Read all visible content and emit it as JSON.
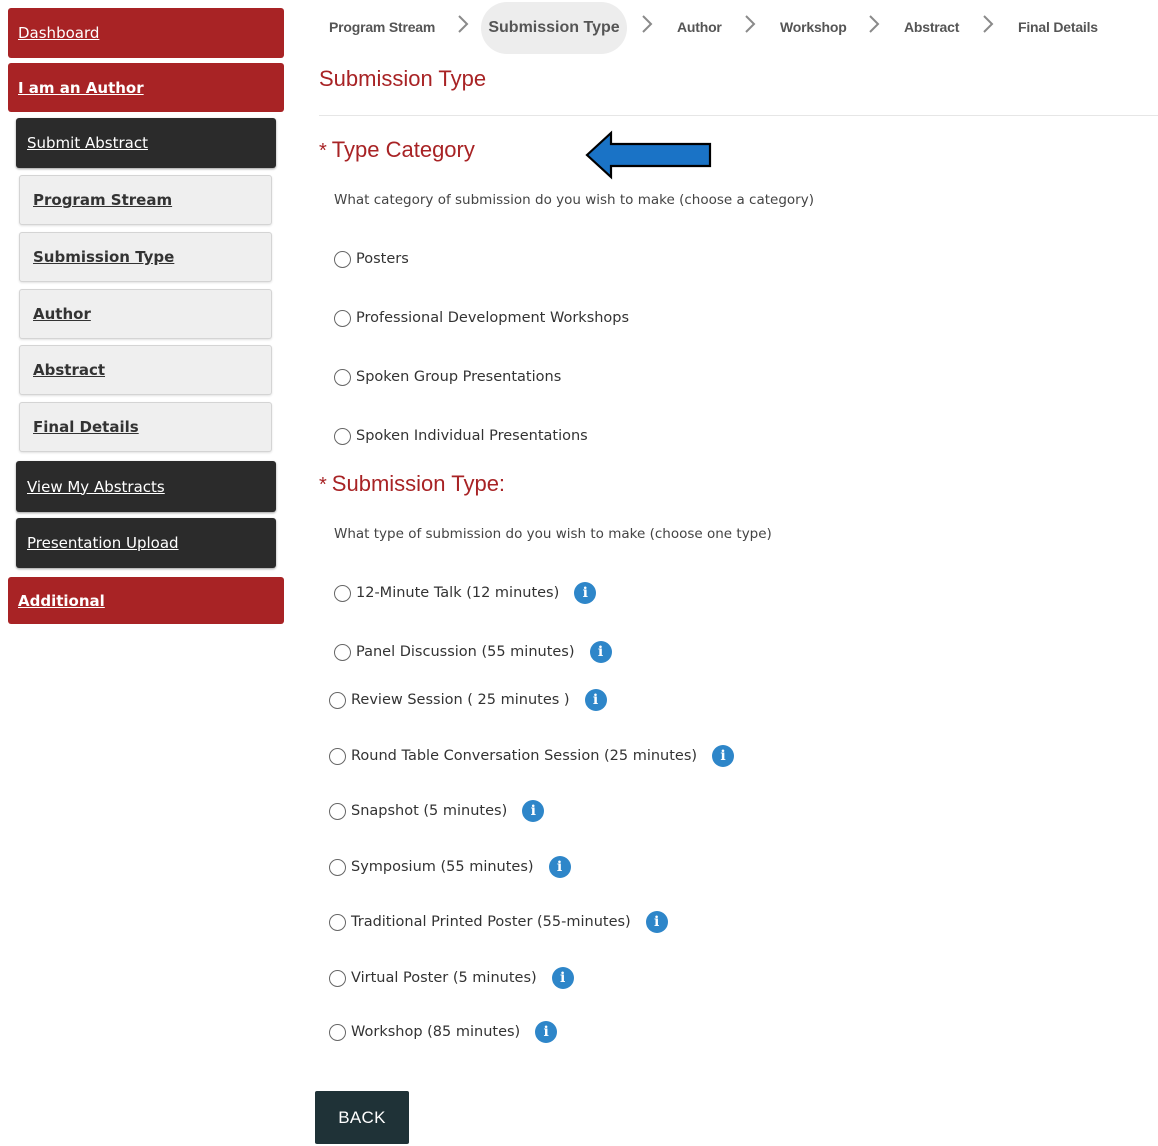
{
  "sidebar": {
    "dashboard": "Dashboard",
    "author_section": "I am an Author",
    "submit_abstract": "Submit Abstract",
    "steps": [
      "Program Stream",
      "Submission Type",
      "Author",
      "Abstract",
      "Final Details"
    ],
    "view_abstracts": "View My Abstracts",
    "presentation_upload": "Presentation Upload",
    "additional": "Additional"
  },
  "breadcrumb": {
    "items": [
      "Program Stream",
      "Submission Type",
      "Author",
      "Workshop",
      "Abstract",
      "Final Details"
    ],
    "active": "Submission Type"
  },
  "page_title": "Submission Type",
  "category": {
    "title": "Type Category",
    "required_marker": "*",
    "description": "What category of submission do you wish to make (choose a category)",
    "options": [
      "Posters",
      "Professional Development Workshops",
      "Spoken Group Presentations",
      "Spoken Individual Presentations"
    ]
  },
  "submission_type": {
    "title": "Submission Type:",
    "required_marker": "*",
    "description": "What type of submission do you wish to make (choose one type)",
    "options": [
      "12-Minute Talk (12 minutes)",
      "Panel Discussion (55 minutes)",
      "Review Session ( 25 minutes )",
      "Round Table Conversation Session (25 minutes)",
      "Snapshot (5 minutes)",
      "Symposium (55 minutes)",
      "Traditional Printed Poster (55-minutes)",
      "Virtual Poster (5 minutes)",
      "Workshop (85 minutes)"
    ]
  },
  "info_icon_glyph": "i",
  "back_label": "BACK",
  "colors": {
    "brand_red": "#a82325",
    "sidebar_dark": "#2b2b2b",
    "info_blue": "#2e86c9",
    "button_dark": "#1f3237",
    "annotation_arrow": "#1a73c6"
  },
  "icons": {
    "breadcrumb_separator": "chevron-right-icon",
    "info": "info-icon",
    "annotation": "arrow-left-icon"
  }
}
